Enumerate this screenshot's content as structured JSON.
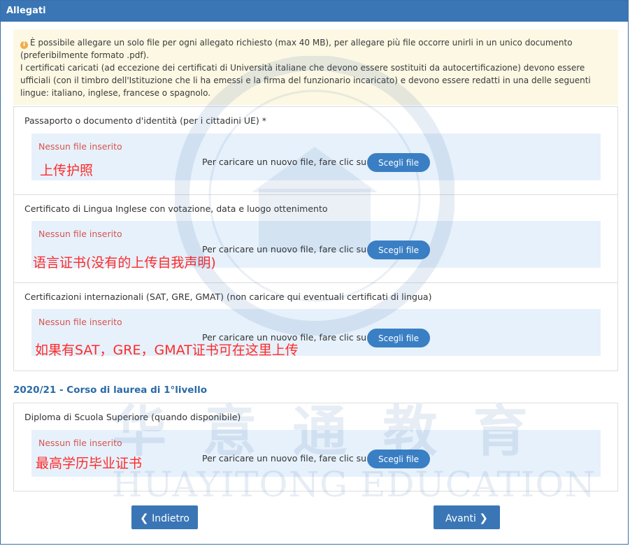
{
  "header": {
    "title": "Allegati"
  },
  "info": {
    "icon": "info-icon",
    "line1": "È possibile allegare un solo file per ogni allegato richiesto (max 40 MB), per allegare più file occorre unirli in un unico documento (preferibilmente formato .pdf).",
    "line2": "I certificati caricati (ad eccezione dei certificati di Università italiane che devono essere sostituiti da autocertificazione) devono essere ufficiali (con il timbro dell'Istituzione che li ha emessi e la firma del funzionario incaricato) e devono essere redatti in una delle seguenti lingue: italiano, inglese, francese o spagnolo."
  },
  "sections": [
    {
      "label": "Passaporto o documento d'identità (per i cittadini UE) *",
      "no_file": "Nessun file inserito",
      "hint": "Per caricare un nuovo file, fare clic su",
      "button": "Scegli file",
      "annotation": "上传护照"
    },
    {
      "label": "Certificato di Lingua Inglese con votazione, data e luogo ottenimento",
      "no_file": "Nessun file inserito",
      "hint": "Per caricare un nuovo file, fare clic su",
      "button": "Scegli file",
      "annotation": "语言证书(没有的上传自我声明)"
    },
    {
      "label": "Certificazioni internazionali (SAT, GRE, GMAT) (non caricare qui eventuali certificati di lingua)",
      "no_file": "Nessun file inserito",
      "hint": "Per caricare un nuovo file, fare clic su",
      "button": "Scegli file",
      "annotation": "如果有SAT，GRE，GMAT证书可在这里上传"
    },
    {
      "label": "Diploma di Scuola Superiore (quando disponibile)",
      "no_file": "Nessun file inserito",
      "hint": "Per caricare un nuovo file, fare clic su",
      "button": "Scegli file",
      "annotation": "最高学历毕业证书"
    }
  ],
  "course_title": "2020/21 - Corso di laurea di 1°livello",
  "nav": {
    "back_label": "Indietro",
    "next_label": "Avanti"
  },
  "watermark": {
    "cn": "华 意 通 教 育",
    "en": "HUAYITONG EDUCATION"
  },
  "colors": {
    "header_bg": "#3a76b6",
    "info_bg": "#fcf8e3",
    "upload_bg": "#e6f1fb",
    "no_file": "#d9534f",
    "annotation": "#ff2a2a",
    "button": "#3a7fc4"
  }
}
